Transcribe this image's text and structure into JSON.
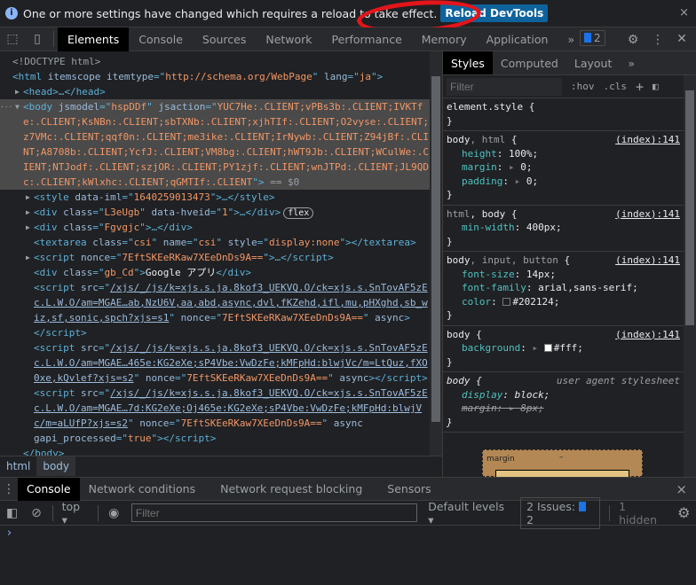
{
  "infobar": {
    "message": "One or more settings have changed which requires a reload to take effect.",
    "reload_label": "Reload DevTools",
    "close": "×"
  },
  "toolbar": {
    "tabs": [
      "Elements",
      "Console",
      "Sources",
      "Network",
      "Performance",
      "Memory",
      "Application"
    ],
    "more": "»",
    "issues_count": "2",
    "icons": [
      "inspect-icon",
      "device-toggle-icon",
      "settings-icon",
      "more-vert-icon",
      "close-icon"
    ]
  },
  "elements": {
    "lines": [
      {
        "depth": 0,
        "segs": [
          [
            "d",
            "<!DOCTYPE html>"
          ]
        ]
      },
      {
        "depth": 0,
        "segs": [
          [
            "t",
            "<html "
          ],
          [
            "a",
            "itemscope itemtype"
          ],
          [
            "t",
            "=\""
          ],
          [
            "v",
            "http://schema.org/WebPage"
          ],
          [
            "t",
            "\" "
          ],
          [
            "a",
            "lang"
          ],
          [
            "t",
            "=\""
          ],
          [
            "v",
            "ja"
          ],
          [
            "t",
            "\">"
          ]
        ]
      },
      {
        "depth": 1,
        "arrow": "▶",
        "segs": [
          [
            "t",
            "<head>…</head>"
          ]
        ]
      },
      {
        "depth": 1,
        "arrow": "▼",
        "sel": true,
        "segs": [
          [
            "t",
            "<body "
          ],
          [
            "a",
            "jsmodel"
          ],
          [
            "t",
            "=\""
          ],
          [
            "v",
            "hspDDf"
          ],
          [
            "t",
            "\" "
          ],
          [
            "a",
            "jsaction"
          ],
          [
            "t",
            "=\""
          ],
          [
            "v",
            "YUC7He:.CLIENT;vPBs3b:.CLIENT;IVKTf"
          ]
        ]
      },
      {
        "depth": 1,
        "sel": true,
        "segs": [
          [
            "v",
            "e:.CLIENT;KsNBn:.CLIENT;sbTXNb:.CLIENT;xjhTIf:.CLIENT;O2vyse:.CLIENT;E"
          ]
        ]
      },
      {
        "depth": 1,
        "sel": true,
        "segs": [
          [
            "v",
            "z7VMc:.CLIENT;qqf0n:.CLIENT;me3ike:.CLIENT;IrNywb:.CLIENT;Z94jBf:.CLIE"
          ]
        ]
      },
      {
        "depth": 1,
        "sel": true,
        "segs": [
          [
            "v",
            "NT;A8708b:.CLIENT;YcfJ:.CLIENT;VM8bg:.CLIENT;hWT9Jb:.CLIENT;WCulWe:.CL"
          ]
        ]
      },
      {
        "depth": 1,
        "sel": true,
        "segs": [
          [
            "v",
            "IENT;NTJodf:.CLIENT;szjOR:.CLIENT;PY1zjf:.CLIENT;wnJTPd:.CLIENT;JL9QD"
          ]
        ]
      },
      {
        "depth": 1,
        "sel": true,
        "segs": [
          [
            "v",
            "c:.CLIENT;kWlxhc:.CLIENT;qGMTIf:.CLIENT"
          ],
          [
            "t",
            "\">"
          ],
          [
            "d",
            " == $0"
          ]
        ]
      },
      {
        "depth": 2,
        "arrow": "▶",
        "segs": [
          [
            "t",
            "<style "
          ],
          [
            "a",
            "data-iml"
          ],
          [
            "t",
            "=\""
          ],
          [
            "v",
            "1640259013473"
          ],
          [
            "t",
            "\">…</style>"
          ]
        ]
      },
      {
        "depth": 2,
        "arrow": "▶",
        "segs": [
          [
            "t",
            "<div "
          ],
          [
            "a",
            "class"
          ],
          [
            "t",
            "=\""
          ],
          [
            "v",
            "L3eUgb"
          ],
          [
            "t",
            "\" "
          ],
          [
            "a",
            "data-hveid"
          ],
          [
            "t",
            "=\""
          ],
          [
            "v",
            "1"
          ],
          [
            "t",
            "\">…</div>"
          ]
        ],
        "badge": "flex"
      },
      {
        "depth": 2,
        "arrow": "▶",
        "segs": [
          [
            "t",
            "<div "
          ],
          [
            "a",
            "class"
          ],
          [
            "t",
            "=\""
          ],
          [
            "v",
            "Fgvgjc"
          ],
          [
            "t",
            "\">…</div>"
          ]
        ]
      },
      {
        "depth": 2,
        "segs": [
          [
            "t",
            "<textarea "
          ],
          [
            "a",
            "class"
          ],
          [
            "t",
            "=\""
          ],
          [
            "v",
            "csi"
          ],
          [
            "t",
            "\" "
          ],
          [
            "a",
            "name"
          ],
          [
            "t",
            "=\""
          ],
          [
            "v",
            "csi"
          ],
          [
            "t",
            "\" "
          ],
          [
            "a",
            "style"
          ],
          [
            "t",
            "=\""
          ],
          [
            "v",
            "display:none"
          ],
          [
            "t",
            "\"></textarea>"
          ]
        ]
      },
      {
        "depth": 2,
        "arrow": "▶",
        "segs": [
          [
            "t",
            "<script "
          ],
          [
            "a",
            "nonce"
          ],
          [
            "t",
            "=\""
          ],
          [
            "v",
            "7EftSKEeRKaw7XEeDnDs9A=="
          ],
          [
            "t",
            "\">…</script>"
          ]
        ]
      },
      {
        "depth": 2,
        "segs": [
          [
            "t",
            "<div "
          ],
          [
            "a",
            "class"
          ],
          [
            "t",
            "=\""
          ],
          [
            "v",
            "gb_Cd"
          ],
          [
            "t",
            "\">"
          ],
          [
            "x",
            "Google アプリ"
          ],
          [
            "t",
            "</div>"
          ]
        ]
      },
      {
        "depth": 2,
        "segs": [
          [
            "t",
            "<script "
          ],
          [
            "a",
            "src"
          ],
          [
            "t",
            "=\""
          ],
          [
            "l",
            "/xjs/_/js/k=xjs.s.ja.8kof3_UEKVQ.O/ck=xjs.s.SnTovAF5zE"
          ]
        ]
      },
      {
        "depth": 2,
        "segs": [
          [
            "l",
            "c.L.W.O/am=MGAE…ab,NzU6V,aa,abd,async,dvl,fKZehd,ifl,mu,pHXghd,sb_w"
          ]
        ]
      },
      {
        "depth": 2,
        "segs": [
          [
            "l",
            "iz,sf,sonic,spch?xjs=s1"
          ],
          [
            "t",
            "\" "
          ],
          [
            "a",
            "nonce"
          ],
          [
            "t",
            "=\""
          ],
          [
            "v",
            "7EftSKEeRKaw7XEeDnDs9A=="
          ],
          [
            "t",
            "\" "
          ],
          [
            "a",
            "async"
          ],
          [
            "t",
            ">"
          ]
        ]
      },
      {
        "depth": 2,
        "segs": [
          [
            "t",
            "</script>"
          ]
        ]
      },
      {
        "depth": 2,
        "segs": [
          [
            "t",
            "<script "
          ],
          [
            "a",
            "src"
          ],
          [
            "t",
            "=\""
          ],
          [
            "l",
            "/xjs/_/js/k=xjs.s.ja.8kof3_UEKVQ.O/ck=xjs.s.SnTovAF5zE"
          ]
        ]
      },
      {
        "depth": 2,
        "segs": [
          [
            "l",
            "c.L.W.O/am=MGAE…465e:KG2eXe;sP4Vbe:VwDzFe;kMFpHd:blwjVc/m=LtQuz,fXO"
          ]
        ]
      },
      {
        "depth": 2,
        "segs": [
          [
            "l",
            "0xe,kQvlef?xjs=s2"
          ],
          [
            "t",
            "\" "
          ],
          [
            "a",
            "nonce"
          ],
          [
            "t",
            "=\""
          ],
          [
            "v",
            "7EftSKEeRKaw7XEeDnDs9A=="
          ],
          [
            "t",
            "\" "
          ],
          [
            "a",
            "async"
          ],
          [
            "t",
            "></script>"
          ]
        ]
      },
      {
        "depth": 2,
        "segs": [
          [
            "t",
            "<script "
          ],
          [
            "a",
            "src"
          ],
          [
            "t",
            "=\""
          ],
          [
            "l",
            "/xjs/_/js/k=xjs.s.ja.8kof3_UEKVQ.O/ck=xjs.s.SnTovAF5zE"
          ]
        ]
      },
      {
        "depth": 2,
        "segs": [
          [
            "l",
            "c.L.W.O/am=MGAE…7d:KG2eXe;Oj465e:KG2eXe;sP4Vbe:VwDzFe;kMFpHd:blwjV"
          ]
        ]
      },
      {
        "depth": 2,
        "segs": [
          [
            "l",
            "c/m=aLUfP?xjs=s2"
          ],
          [
            "t",
            "\" "
          ],
          [
            "a",
            "nonce"
          ],
          [
            "t",
            "=\""
          ],
          [
            "v",
            "7EftSKEeRKaw7XEeDnDs9A=="
          ],
          [
            "t",
            "\" "
          ],
          [
            "a",
            "async"
          ]
        ]
      },
      {
        "depth": 2,
        "segs": [
          [
            "a",
            "gapi_processed"
          ],
          [
            "t",
            "=\""
          ],
          [
            "v",
            "true"
          ],
          [
            "t",
            "\"></script>"
          ]
        ]
      },
      {
        "depth": 1,
        "segs": [
          [
            "t",
            "</body>"
          ]
        ]
      }
    ]
  },
  "breadcrumbs": [
    "html",
    "body"
  ],
  "styles": {
    "tabs": [
      "Styles",
      "Computed",
      "Layout"
    ],
    "more": "»",
    "filter_placeholder": "Filter",
    "hov": ":hov",
    "cls": ".cls",
    "add": "+",
    "rules": [
      {
        "selector": [
          [
            "m",
            "element.style"
          ]
        ],
        "props": []
      },
      {
        "selector": [
          [
            "m",
            "body"
          ],
          [
            "d",
            ", html"
          ]
        ],
        "source": "(index):141",
        "props": [
          {
            "name": "height",
            "value": "100%;"
          },
          {
            "name": "margin",
            "value": "0;",
            "expand": true
          },
          {
            "name": "padding",
            "value": "0;",
            "expand": true
          }
        ]
      },
      {
        "selector": [
          [
            "d",
            "html"
          ],
          [
            "m",
            ", body"
          ]
        ],
        "source": "(index):141",
        "props": [
          {
            "name": "min-width",
            "value": "400px;"
          }
        ]
      },
      {
        "selector": [
          [
            "m",
            "body"
          ],
          [
            "d",
            ", input, button"
          ]
        ],
        "source": "(index):141",
        "props": [
          {
            "name": "font-size",
            "value": "14px;"
          },
          {
            "name": "font-family",
            "value": "arial,sans-serif;"
          },
          {
            "name": "color",
            "value": "#202124;",
            "swatch": "#202124"
          }
        ]
      },
      {
        "selector": [
          [
            "m",
            "body"
          ]
        ],
        "source": "(index):141",
        "props": [
          {
            "name": "background",
            "value": "#fff;",
            "expand": true,
            "swatch": "#ffffff"
          }
        ]
      },
      {
        "selector": [
          [
            "m",
            "body"
          ]
        ],
        "source": "user agent stylesheet",
        "ua": true,
        "props": [
          {
            "name": "display",
            "value": "block;"
          },
          {
            "name": "margin",
            "value": "8px;",
            "expand": true,
            "struck": true
          }
        ]
      }
    ],
    "boxmodel": {
      "label": "margin",
      "value": "–"
    }
  },
  "drawer": {
    "tabs": [
      "Console",
      "Network conditions",
      "Network request blocking",
      "Sensors"
    ],
    "close": "×"
  },
  "console": {
    "context": "top",
    "filter_placeholder": "Filter",
    "levels": "Default levels",
    "issues_label": "2 Issues:",
    "issues_count": "2",
    "hidden": "1 hidden",
    "prompt": "›"
  }
}
